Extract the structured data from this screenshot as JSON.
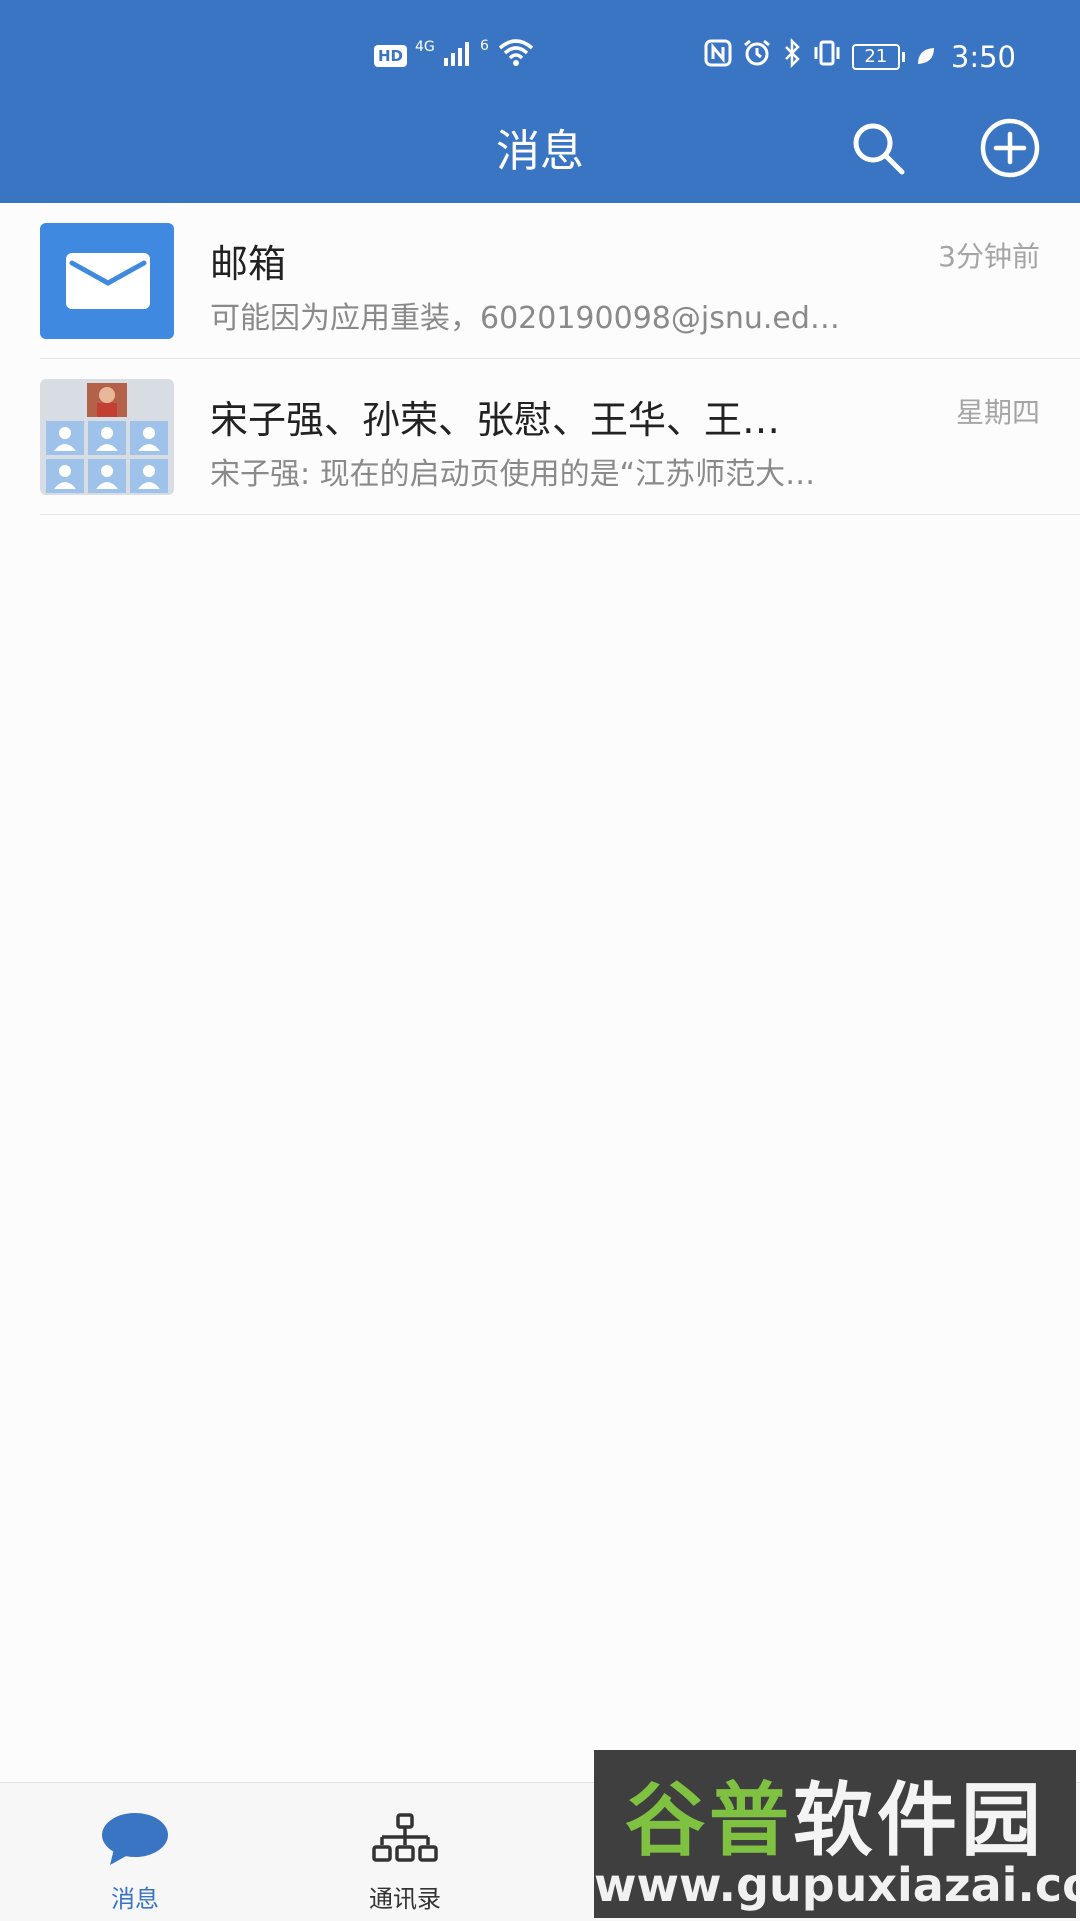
{
  "status_bar": {
    "hd": "HD",
    "network": "4G",
    "wifi_badge": "6",
    "battery": "21",
    "time": "3:50"
  },
  "header": {
    "title": "消息"
  },
  "conversations": [
    {
      "title": "邮箱",
      "subtitle": "可能因为应用重装，6020190098@jsnu.ed…",
      "time": "3分钟前",
      "avatar": "mail-icon"
    },
    {
      "title": "宋子强、孙荣、张慰、王华、王…",
      "subtitle": "宋子强: 现在的启动页使用的是“江苏师范大…",
      "time": "星期四",
      "avatar": "group-avatar"
    }
  ],
  "tabs": [
    {
      "label": "消息",
      "icon": "chat-bubble-icon",
      "active": true
    },
    {
      "label": "通讯录",
      "icon": "org-chart-icon",
      "active": false
    }
  ],
  "watermark": {
    "brand_part1": "谷普",
    "brand_part2": "软件园",
    "url": "www.gupuxiazai.com"
  },
  "colors": {
    "header_bg": "#3a75c4",
    "accent": "#3a75c4",
    "mail_avatar": "#3f8ae0"
  }
}
